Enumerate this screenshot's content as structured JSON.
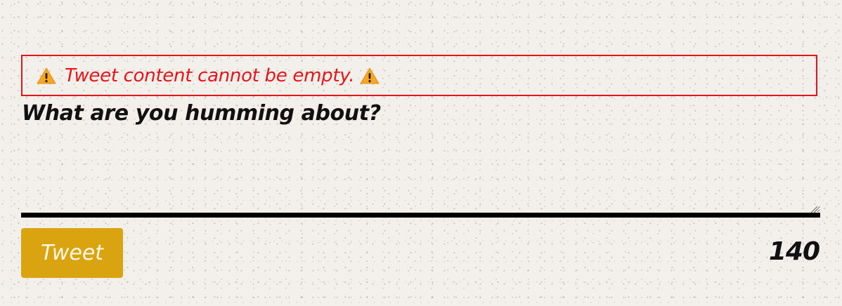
{
  "error": {
    "message": "Tweet content cannot be empty.",
    "icon": "warning-icon",
    "color": "#e8141a",
    "icon_color": "#f5a623"
  },
  "composer": {
    "prompt": "What are you humming about?",
    "textarea_value": "",
    "underline_color": "#000000"
  },
  "actions": {
    "tweet_label": "Tweet",
    "tweet_button_color": "#d9a40f"
  },
  "counter": {
    "remaining": "140"
  }
}
